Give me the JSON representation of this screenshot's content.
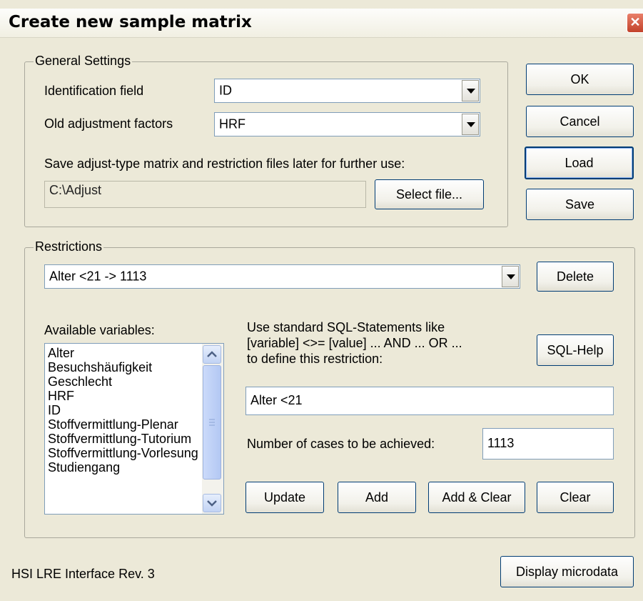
{
  "window": {
    "title": "Create new sample matrix",
    "close_icon": "close-icon"
  },
  "general": {
    "legend": "General Settings",
    "id_label": "Identification field",
    "id_value": "ID",
    "old_label": "Old adjustment factors",
    "old_value": "HRF",
    "save_note": "Save adjust-type matrix and restriction files later for further use:",
    "path_value": "C:\\Adjust",
    "select_file": "Select file..."
  },
  "side_buttons": {
    "ok": "OK",
    "cancel": "Cancel",
    "load": "Load",
    "save": "Save"
  },
  "restrictions": {
    "legend": "Restrictions",
    "current": "Alter <21 -> 1113",
    "delete": "Delete",
    "available_label": "Available variables:",
    "variables": [
      "Alter",
      "Besuchshäufigkeit",
      "Geschlecht",
      "HRF",
      "ID",
      "Stoffvermittlung-Plenar",
      "Stoffvermittlung-Tutorium",
      "Stoffvermittlung-Vorlesung",
      "Studiengang"
    ],
    "sql_hint": [
      "Use standard SQL-Statements like",
      "[variable] <>= [value] ... AND ... OR ...",
      "to define this restriction:"
    ],
    "sql_help": "SQL-Help",
    "statement": "Alter <21",
    "cases_label": "Number of cases to be achieved:",
    "cases_value": "1113",
    "update": "Update",
    "add": "Add",
    "add_clear": "Add & Clear",
    "clear": "Clear"
  },
  "footer": {
    "version": "HSI LRE Interface Rev. 3",
    "display_microdata": "Display microdata"
  }
}
